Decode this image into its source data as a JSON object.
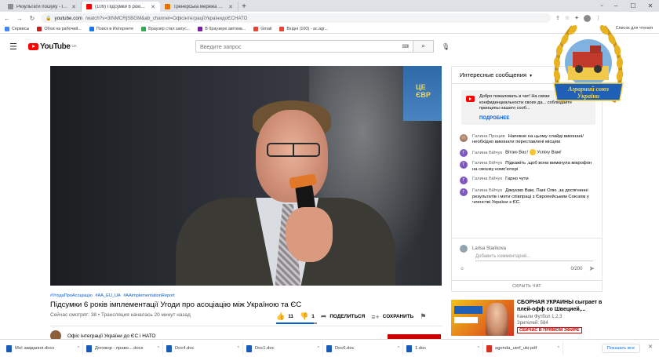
{
  "browser": {
    "tabs": [
      {
        "title": "Результати пошуку - larisa.starikova@...",
        "color": "#5f6368"
      },
      {
        "title": "(109) Підсумки 6 років імплементації...",
        "color": "#ff0000"
      },
      {
        "title": "Тренерська мережа К2К",
        "color": "#e37400"
      }
    ],
    "new_tab": "+",
    "url_host": "youtube.com",
    "url_path": "/watch?v=3tNMCRjSBGM&ab_channel=ОфісінтеграціїУкраїнидоЄСНАТО",
    "bookmarks": [
      {
        "label": "Сервисы",
        "color": "#4285f4"
      },
      {
        "label": "Обои на рабочий...",
        "color": "#c5221f"
      },
      {
        "label": "Поиск в Интернете",
        "color": "#1a73e8"
      },
      {
        "label": "Браузер стал запус...",
        "color": "#34a853"
      },
      {
        "label": "В браузере автома...",
        "color": "#7b1fa2"
      },
      {
        "label": "Gmail",
        "color": "#ea4335"
      },
      {
        "label": "Вхідні (100) - ac.agr...",
        "color": "#ea4335"
      }
    ],
    "reading_list": "Список для чтения"
  },
  "youtube": {
    "logo_word": "YouTube",
    "logo_region": "UA",
    "search_placeholder": "Введите запрос"
  },
  "video": {
    "banner_text": "ЦЕ ЄВР",
    "hashtags": [
      "#УгодаПроАсоціацію",
      "#AA_EU_UA",
      "#AAimplementationReport"
    ],
    "title": "Підсумки 6 років імплементації Угоди про асоціацію між Україною та ЄС",
    "meta": "Сейчас смотрят: 38 • Трансляция началась 20 минут назад",
    "likes": "11",
    "dislikes": "1",
    "share_label": "ПОДЕЛИТЬСЯ",
    "save_label": "СОХРАНИТЬ",
    "channel_name": "Офіс інтеграції України до ЄС і НАТО",
    "like_ratio": 0.92
  },
  "chat": {
    "header": "Интересные сообщения",
    "welcome_text": "Добро пожаловать в чат! На связи конфиденциальности своих да... соблюдайте принципы нашего сооб...",
    "welcome_more": "ПОДРОБНЕЕ",
    "messages": [
      {
        "author": "Галина Процив",
        "text": "Напевне на цьому слайді виконані/ необхідно виконати переставлені місцем",
        "avatar": ""
      },
      {
        "author": "Галина Бійчук",
        "text": "Вітаю Вас!",
        "text2": "Успіху Вам!",
        "avatar": "Г"
      },
      {
        "author": "Галина Бійчук",
        "text": "Підкажіть ,щоб вона вимкнула мікрофон на своєму комп'ютері",
        "avatar": "Г"
      },
      {
        "author": "Галина Бійчук",
        "text": "Гарно чути",
        "avatar": "Г"
      },
      {
        "author": "Галина Бійчук",
        "text": "Дякуємо Вам, Пані Олю ,за досягненні результатів і мети співпраці з Європейським Союзом у членстві України з ЄС.",
        "avatar": "Г"
      }
    ],
    "input_user": "Larisa Starikova",
    "input_placeholder": "Добавить комментарий...",
    "char_count": "0/200",
    "hide_chat": "СКРЫТЬ ЧАТ"
  },
  "recommendation": {
    "title": "СБОРНАЯ УКРАИНЫ сыграет в плей-офф со Швецией,...",
    "channel": "Канали Футбол 1,2,3",
    "views": "Зрителей: 584",
    "live_badge": "СЕЙЧАС В ПРЯМОМ ЭФИРЕ"
  },
  "logo_overlay": {
    "text_line1": "Аграрний союз",
    "text_line2": "України"
  },
  "downloads": {
    "items": [
      {
        "name": "Мої завдання.docx",
        "type": "doc"
      },
      {
        "name": "Договор - право....docx",
        "type": "doc"
      },
      {
        "name": "Doc4.doc",
        "type": "doc"
      },
      {
        "name": "Doc1.doc",
        "type": "doc"
      },
      {
        "name": "Doc6.doc",
        "type": "doc"
      },
      {
        "name": "1.doc",
        "type": "doc"
      },
      {
        "name": "agenda_uerf_ukr.pdf",
        "type": "pdf"
      }
    ],
    "show_all": "Показать все"
  }
}
